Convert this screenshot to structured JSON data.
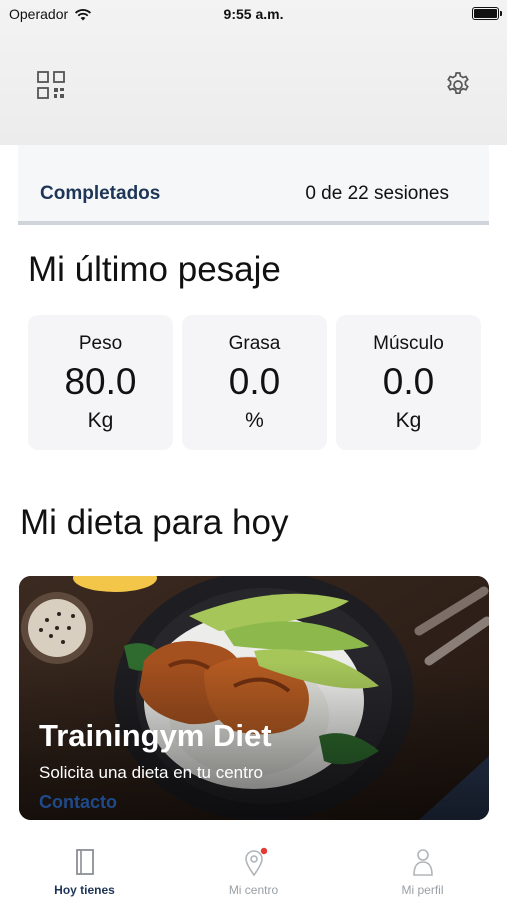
{
  "status_bar": {
    "carrier": "Operador",
    "time": "9:55 a.m."
  },
  "header": {
    "qr_icon": "qr-code-icon",
    "settings_icon": "gear-icon"
  },
  "completed": {
    "label": "Completados",
    "value": "0 de 22 sesiones"
  },
  "weigh_in": {
    "title": "Mi último pesaje",
    "metrics": [
      {
        "label": "Peso",
        "value": "80.0",
        "unit": "Kg"
      },
      {
        "label": "Grasa",
        "value": "0.0",
        "unit": "%"
      },
      {
        "label": "Músculo",
        "value": "0.0",
        "unit": "Kg"
      }
    ]
  },
  "diet": {
    "title": "Mi dieta para hoy",
    "card_title": "Trainingym Diet",
    "card_subtitle": "Solicita una dieta en tu centro",
    "card_link": "Contacto"
  },
  "tabbar": {
    "tabs": [
      {
        "label": "Hoy tienes",
        "icon": "book-icon",
        "active": true
      },
      {
        "label": "Mi centro",
        "icon": "location-pin-icon",
        "active": false,
        "badge": true
      },
      {
        "label": "Mi perfil",
        "icon": "person-icon",
        "active": false
      }
    ]
  },
  "colors": {
    "accent": "#1d3557",
    "link": "#1f4a8a",
    "badge": "#e53935",
    "inactive": "#9aa0a6"
  }
}
